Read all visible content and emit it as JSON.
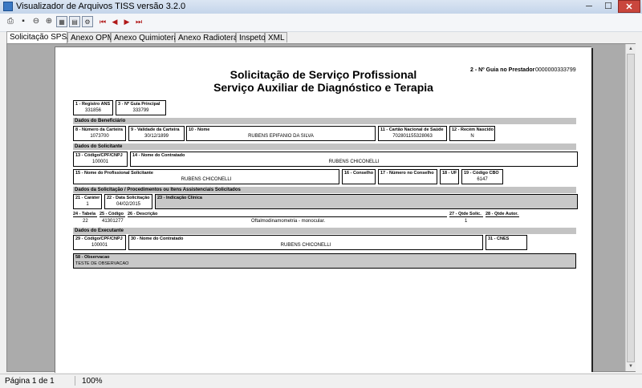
{
  "window": {
    "title": "Visualizador de Arquivos TISS versão 3.2.0",
    "min": "─",
    "max": "☐",
    "close": "✕"
  },
  "toolbar": {
    "print": "⎙",
    "save": "▪",
    "zoom_out": "⊖",
    "zoom_in": "⊕",
    "fit": "▦",
    "page": "▤",
    "settings": "⚙",
    "first": "⏮",
    "prev": "◀",
    "next": "▶",
    "last": "⏭"
  },
  "tabs": [
    "Solicitação SPSADT",
    "Anexo OPME",
    "Anexo Quimioterapia",
    "Anexo Radioterapia",
    "Inspetor",
    "XML"
  ],
  "status": {
    "page": "Página 1 de 1",
    "zoom": "100%"
  },
  "doc": {
    "title1": "Solicitação de Serviço Profissional",
    "title2": "Serviço Auxiliar de Diagnóstico e Terapia",
    "guia_prestador_label": "2 - Nº Guia no Prestador",
    "guia_prestador_value": "0000000333799",
    "f1_label": "1 - Registro ANS",
    "f1_value": "331856",
    "f3_label": "3 - Nº Guia Principal",
    "f3_value": "333799",
    "sec_beneficiario": "Dados do Beneficiário",
    "f8_label": "8 - Número da Carteira",
    "f8_value": "1073700",
    "f9_label": "9 - Validade da Carteira",
    "f9_value": "30/12/1899",
    "f10_label": "10 - Nome",
    "f10_value": "RUBENS EPIFANIO DA SILVA",
    "f11_label": "11 - Cartão Nacional de Saúde",
    "f11_value": "702801155328063",
    "f12_label": "12 - Recém Nascido",
    "f12_value": "N",
    "sec_solicitante": "Dados do Solicitante",
    "f13_label": "13 - Código/CPF/CNPJ",
    "f13_value": "100001",
    "f14_label": "14 - Nome do Contratado",
    "f14_value": "RUBENS CHICONELLI",
    "f15_label": "15 - Nome do Profissional Solicitante",
    "f15_value": "RUBENS CHICONELLI",
    "f16_label": "16 - Conselho",
    "f17_label": "17 - Número no Conselho",
    "f18_label": "18 - UF",
    "f19_label": "19 - Código CBO",
    "f19_value": "6147",
    "sec_solicitacao": "Dados da Solicitação / Procedimentos ou Itens Assistenciais Solicitados",
    "f21_label": "21 - Caráter",
    "f21_value": "1",
    "f22_label": "22 - Data Solicitação",
    "f22_value": "04/02/2015",
    "f23_label": "23 - Indicação Clínica",
    "f24_label": "24 - Tabela",
    "f24_value": "22",
    "f25_label": "25 - Código",
    "f25_value": "41301277",
    "f26_label": "26 - Descrição",
    "f26_value": "Oftalmodinamometria - monocular.",
    "f27_label": "27 - Qtde Solic.",
    "f27_value": "1",
    "f28_label": "28 - Qtde Autor.",
    "sec_executante": "Dados do Executante",
    "f29_label": "29 - Código/CPF/CNPJ",
    "f29_value": "100001",
    "f30_label": "30 - Nome do Contratado",
    "f30_value": "RUBENS CHICONELLI",
    "f31_label": "31 - CNES",
    "f58_label": "58 - Observacao",
    "f58_value": "TESTE DE OBSERVACAO"
  }
}
